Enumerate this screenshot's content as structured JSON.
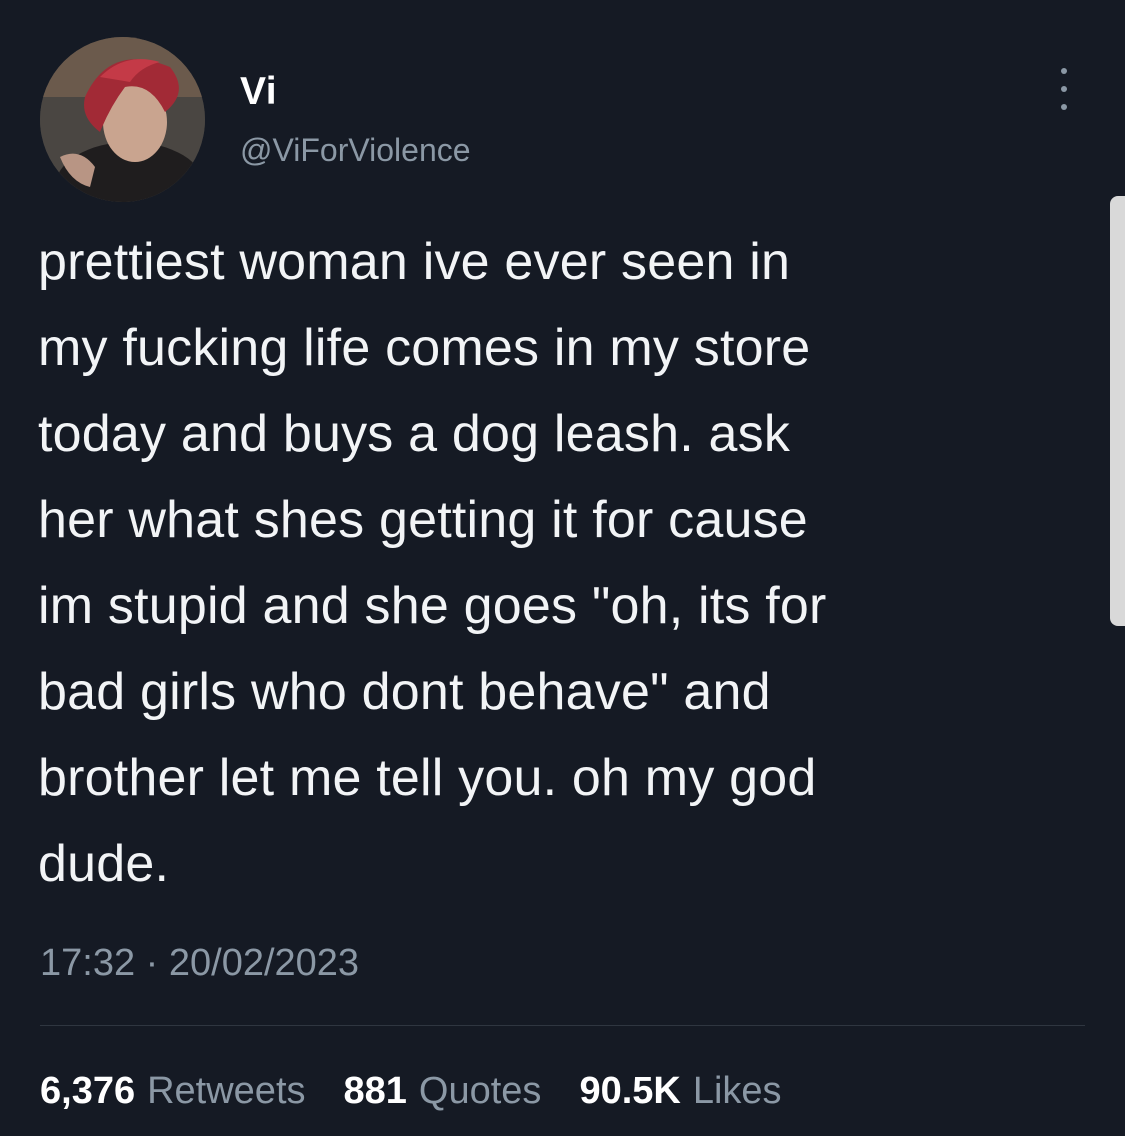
{
  "author": {
    "display_name": "Vi",
    "handle": "@ViForViolence",
    "avatar_icon": "profile-avatar"
  },
  "tweet": {
    "text": "prettiest woman ive ever seen in\nmy fucking life comes in my store\ntoday and buys a dog leash. ask\nher what shes getting it for cause\nim stupid and she goes \"oh, its for\nbad girls who dont behave\" and\nbrother let me tell you. oh my god\ndude.",
    "timestamp": "17:32 · 20/02/2023"
  },
  "stats": {
    "retweets_count": "6,376",
    "retweets_label": "Retweets",
    "quotes_count": "881",
    "quotes_label": "Quotes",
    "likes_count": "90.5K",
    "likes_label": "Likes"
  },
  "colors": {
    "background": "#151a24",
    "primary_text": "#ffffff",
    "secondary_text": "#8b98a5"
  }
}
